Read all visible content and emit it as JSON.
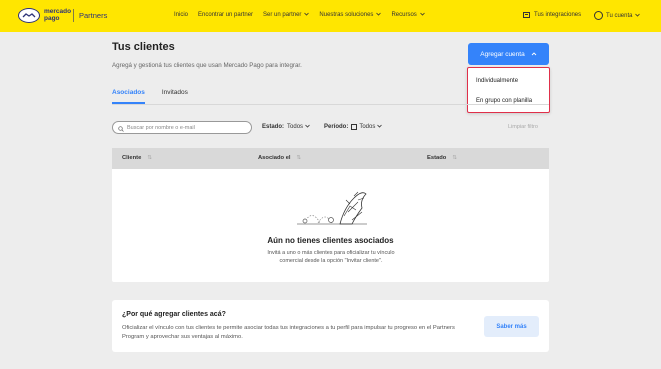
{
  "header": {
    "logo_text": "mercado pago",
    "brand_suffix": "Partners",
    "nav": [
      "Inicio",
      "Encontrar un partner",
      "Ser un partner",
      "Nuestras soluciones",
      "Recursos"
    ],
    "nav_dropdowns": [
      "Ser un partner",
      "Nuestras soluciones",
      "Recursos"
    ],
    "integrations": "Tus integraciones",
    "account": "Tu cuenta",
    "brand_color": "#ffe600"
  },
  "page": {
    "title": "Tus clientes",
    "subtitle": "Agregá y gestioná tus clientes que usan Mercado Pago para integrar.",
    "add_button": "Agregar cuenta",
    "add_menu": [
      "Individualmente",
      "En grupo con planilla"
    ],
    "accent_color": "#3483fa"
  },
  "tabs": [
    "Asociados",
    "Invitados"
  ],
  "filters": {
    "search_placeholder": "Buscar por nombre o e-mail",
    "status_label": "Estado:",
    "status_value": "Todos",
    "period_label": "Período:",
    "period_value": "Todos",
    "clear": "Limpiar filtro"
  },
  "table": {
    "columns": [
      "Cliente",
      "Asociado el",
      "Estado"
    ],
    "empty_title": "Aún no tienes clientes asociados",
    "empty_desc": "Invitá a uno o más clientes para oficializar tu vínculo comercial desde la opción \"Invitar cliente\"."
  },
  "why": {
    "title": "¿Por qué agregar clientes acá?",
    "text": "Oficializar el vínculo con tus clientes te permite asociar todas tus integraciones a tu perfil para impulsar tu progreso en el Partners Program y aprovechar sus ventajas al máximo.",
    "button": "Saber más"
  }
}
